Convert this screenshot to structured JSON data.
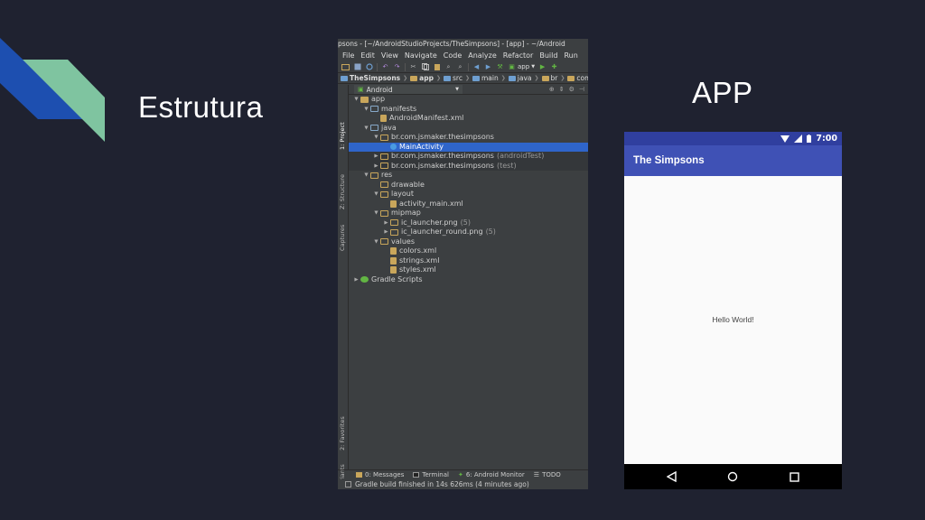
{
  "slide": {
    "title": "Estrutura",
    "app_heading": "APP",
    "colors": {
      "background": "#1f2230",
      "deco_blue": "#1d4fb0",
      "deco_green": "#7fc4a0"
    }
  },
  "ide": {
    "title": "psons - [~/AndroidStudioProjects/TheSimpsons] - [app] - ~/Android",
    "menu": [
      "File",
      "Edit",
      "View",
      "Navigate",
      "Code",
      "Analyze",
      "Refactor",
      "Build",
      "Run"
    ],
    "toolbar": {
      "run_config": "app"
    },
    "breadcrumb": [
      "TheSimpsons",
      "app",
      "src",
      "main",
      "java",
      "br",
      "com"
    ],
    "panel_view": "Android",
    "side_tabs": [
      "1: Project",
      "Z: Structure",
      "Captures",
      "2: Favorites",
      "Build Variants"
    ],
    "tree": [
      {
        "label": "app",
        "depth": 0,
        "expanded": true,
        "icon": "module"
      },
      {
        "label": "manifests",
        "depth": 1,
        "expanded": true,
        "icon": "folder"
      },
      {
        "label": "AndroidManifest.xml",
        "depth": 2,
        "icon": "xml"
      },
      {
        "label": "java",
        "depth": 1,
        "expanded": true,
        "icon": "folder"
      },
      {
        "label": "br.com.jsmaker.thesimpsons",
        "depth": 2,
        "expanded": true,
        "icon": "folder-pkg"
      },
      {
        "label": "MainActivity",
        "depth": 3,
        "icon": "class",
        "selected": true
      },
      {
        "label": "br.com.jsmaker.thesimpsons",
        "suffix": "(androidTest)",
        "depth": 2,
        "collapsed": true,
        "icon": "folder-pkg",
        "highlight": true
      },
      {
        "label": "br.com.jsmaker.thesimpsons",
        "suffix": "(test)",
        "depth": 2,
        "collapsed": true,
        "icon": "folder-pkg",
        "highlight": true
      },
      {
        "label": "res",
        "depth": 1,
        "expanded": true,
        "icon": "res-folder"
      },
      {
        "label": "drawable",
        "depth": 2,
        "icon": "res-folder"
      },
      {
        "label": "layout",
        "depth": 2,
        "expanded": true,
        "icon": "res-folder"
      },
      {
        "label": "activity_main.xml",
        "depth": 3,
        "icon": "xml"
      },
      {
        "label": "mipmap",
        "depth": 2,
        "expanded": true,
        "icon": "res-folder"
      },
      {
        "label": "ic_launcher.png",
        "suffix": "(5)",
        "depth": 3,
        "collapsed": true,
        "icon": "res-folder"
      },
      {
        "label": "ic_launcher_round.png",
        "suffix": "(5)",
        "depth": 3,
        "collapsed": true,
        "icon": "res-folder"
      },
      {
        "label": "values",
        "depth": 2,
        "expanded": true,
        "icon": "res-folder"
      },
      {
        "label": "colors.xml",
        "depth": 3,
        "icon": "xml"
      },
      {
        "label": "strings.xml",
        "depth": 3,
        "icon": "xml"
      },
      {
        "label": "styles.xml",
        "depth": 3,
        "icon": "xml"
      },
      {
        "label": "Gradle Scripts",
        "depth": 0,
        "collapsed": true,
        "icon": "gradle"
      }
    ],
    "tool_windows": [
      {
        "label": "0: Messages",
        "color": "#c9a65b"
      },
      {
        "label": "Terminal",
        "color": "#999999"
      },
      {
        "label": "6: Android Monitor",
        "color": "#62b543"
      },
      {
        "label": "TODO",
        "color": "#bbbbbb"
      }
    ],
    "status": "Gradle build finished in 14s 626ms (4 minutes ago)"
  },
  "phone": {
    "time": "7:00",
    "app_title": "The Simpsons",
    "content_text": "Hello World!",
    "colors": {
      "status_bar": "#303f9f",
      "app_bar": "#3f51b5"
    }
  }
}
